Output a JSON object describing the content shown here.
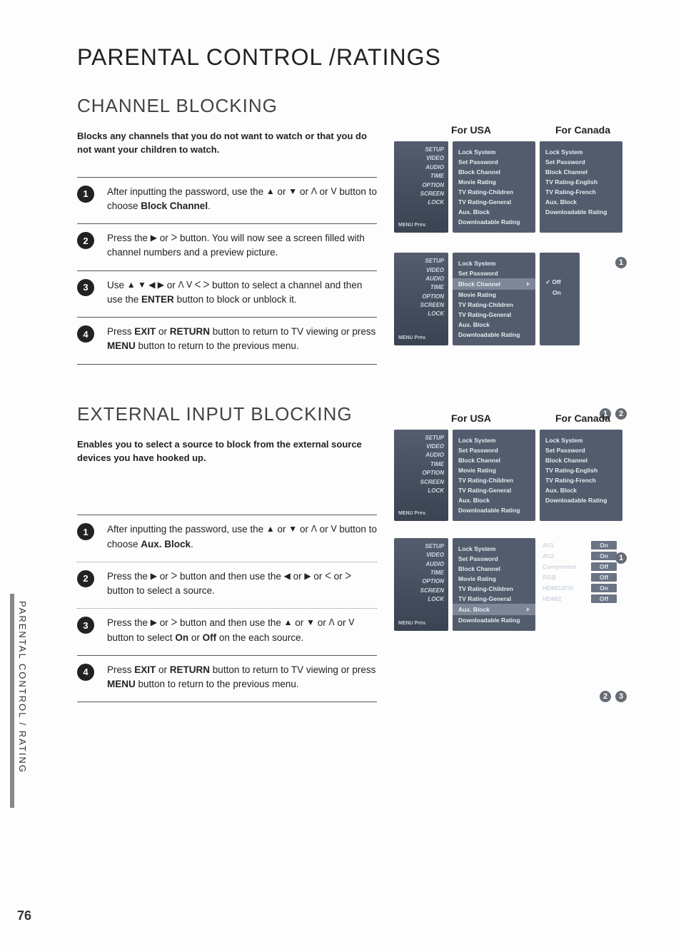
{
  "page": {
    "title": "PARENTAL CONTROL /RATINGS",
    "side_tab": "PARENTAL CONTROL / RATING",
    "number": "76"
  },
  "channel_blocking": {
    "heading": "CHANNEL BLOCKING",
    "intro": "Blocks any channels that you do not want to watch or that you do not want your children to watch.",
    "steps": [
      {
        "n": "1",
        "pre": "After inputting the password, use the  ",
        "mid_a": "▲",
        "mid_b": " or ",
        "mid_c": "▼",
        "mid_d": "  or  ",
        "mid_e": "ᐱ",
        "mid_f": " or  ",
        "mid_g": "ᐯ",
        "mid_h": "  button to choose ",
        "bold": "Block Channel",
        "post": "."
      },
      {
        "n": "2",
        "pre": "Press the ",
        "mid_a": "▶",
        "mid_b": "  or  ",
        "mid_c": "ᐳ",
        "mid_d": "  button. You will now see a screen filled with channel numbers and a preview picture.",
        "bold": "",
        "post": ""
      },
      {
        "n": "3",
        "pre": "Use ",
        "mid_a": "▲ ▼ ◀ ▶",
        "mid_b": " or  ",
        "mid_c": "ᐱ ᐯ ᐸ ᐳ",
        "mid_d": "  button to select a channel and then use the ",
        "bold": "ENTER",
        "post": " button to block or unblock it."
      },
      {
        "n": "4",
        "pre": "Press ",
        "bold": "EXIT",
        "mid_a": " or ",
        "bold2": "RETURN",
        "mid_b": " button to return to TV viewing or press ",
        "bold3": "MENU",
        "post": " button to return to the previous menu."
      }
    ],
    "labels": {
      "usa": "For USA",
      "canada": "For Canada"
    },
    "sidebar": [
      "SETUP",
      "VIDEO",
      "AUDIO",
      "TIME",
      "OPTION",
      "SCREEN",
      "LOCK"
    ],
    "sidebar_prev": "MENU Prev.",
    "usa_items": [
      "Lock System",
      "Set Password",
      "Block Channel",
      "Movie Rating",
      "TV Rating-Children",
      "TV Rating-General",
      "Aux. Block",
      "Downloadable Rating"
    ],
    "canada_items": [
      "Lock System",
      "Set Password",
      "Block Channel",
      "TV Rating-English",
      "TV Rating-French",
      "Aux. Block",
      "Downloadable Rating"
    ],
    "sub_options": {
      "off": "Off",
      "on": "On"
    },
    "badges_a": [
      "1"
    ],
    "badges_b": [
      "1",
      "2"
    ]
  },
  "ext_block": {
    "heading": "EXTERNAL INPUT BLOCKING",
    "intro": "Enables you to select a source to block from the external source devices you have hooked up.",
    "steps": [
      {
        "n": "1",
        "pre": "After inputting the password, use the ",
        "mid_a": "▲",
        "mid_b": " or ",
        "mid_c": "▼",
        "mid_d": "  or  ",
        "mid_e": "ᐱ",
        "mid_f": " or  ",
        "mid_g": "ᐯ",
        "mid_h": "  button to choose ",
        "bold": "Aux. Block",
        "post": "."
      },
      {
        "n": "2",
        "pre": "Press the ",
        "mid_a": "▶",
        "mid_b": "  or  ",
        "mid_c": "ᐳ",
        "mid_d": "  button and then use the ",
        "mid_e": "◀",
        "mid_f": " or ",
        "mid_g": "▶",
        "mid_h": " or  ",
        "mid_i": "ᐸ",
        "mid_j": "  or  ",
        "mid_k": "ᐳ",
        "post": "  button  to select a source."
      },
      {
        "n": "3",
        "pre": "Press the ",
        "mid_a": "▶",
        "mid_b": "  or  ",
        "mid_c": "ᐳ",
        "mid_d": "  button and then use the ",
        "mid_e": "▲",
        "mid_f": " or ",
        "mid_g": "▼",
        "mid_h": " or  ",
        "mid_i": "ᐱ",
        "mid_j": "  or  ",
        "mid_k": "ᐯ",
        "mid_l": "   button to select ",
        "bold": "On",
        "mid_m": " or ",
        "bold2": "Off",
        "post": " on the each source."
      },
      {
        "n": "4",
        "pre": "Press ",
        "bold": "EXIT",
        "mid_a": " or ",
        "bold2": "RETURN",
        "mid_b": " button to return to TV viewing or press ",
        "bold3": "MENU",
        "post": " button to return to the previous menu."
      }
    ],
    "labels": {
      "usa": "For USA",
      "canada": "For Canada"
    },
    "aux_rows": [
      {
        "label": "AV1",
        "val": "On"
      },
      {
        "label": "AV2",
        "val": "On"
      },
      {
        "label": "Component",
        "val": "Off"
      },
      {
        "label": "RGB",
        "val": "Off"
      },
      {
        "label": "HDMI1/DVI",
        "val": "On"
      },
      {
        "label": "HDMI2",
        "val": "Off"
      }
    ],
    "badges_a": [
      "1"
    ],
    "badges_b": [
      "2",
      "3"
    ]
  }
}
